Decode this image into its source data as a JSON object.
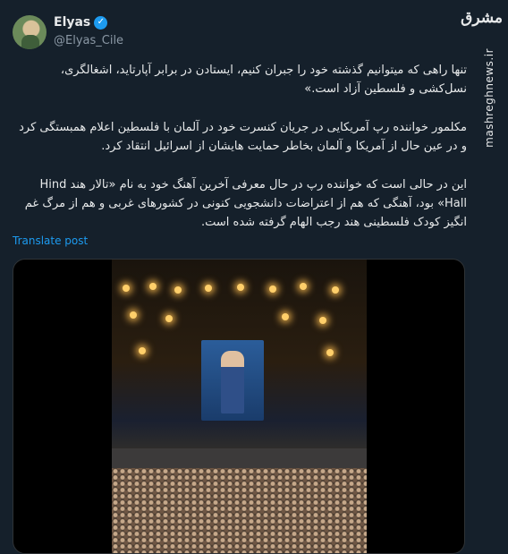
{
  "author": {
    "display_name": "Elyas",
    "handle": "@Elyas_Cile",
    "verified_icon": "verified-badge-icon"
  },
  "tweet": {
    "paragraphs": [
      "تنها راهی که میتوانیم گذشته خود را جبران کنیم، ایستادن در برابر آپارتاید، اشغالگری، نسل‌کشی و فلسطین آزاد است.»",
      "مکلمور خواننده رپ آمریکایی در جریان کنسرت خود در آلمان با فلسطین اعلام همبستگی کرد و در عین حال از آمریکا و آلمان بخاطر حمایت هایشان از اسرائیل انتقاد کرد.",
      "این در حالی است که خواننده رپ در حال معرفی آخرین آهنگ خود به نام «تالار هند Hind Hall» بود، آهنگی که هم از اعتراضات دانشجویی کنونی در کشورهای غربی و هم از مرگ غم انگیز کودک فلسطینی هند رجب الهام گرفته شده است."
    ],
    "translate_label": "Translate post"
  },
  "watermark": {
    "logo_text": "مشرق",
    "site": "mashreghnews.ir"
  },
  "colors": {
    "background": "#15202b",
    "accent": "#1d9bf0",
    "secondary_text": "#8b98a5"
  }
}
